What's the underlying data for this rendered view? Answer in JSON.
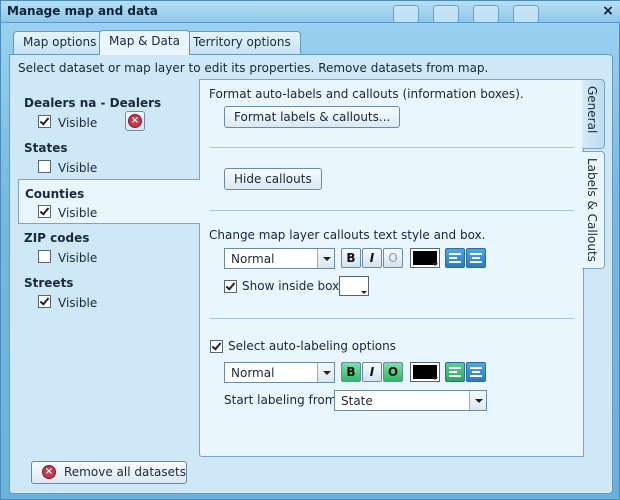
{
  "window": {
    "title": "Manage map and data",
    "close": "×"
  },
  "tabs": [
    {
      "label": "Map options",
      "active": false
    },
    {
      "label": "Map & Data",
      "active": true
    },
    {
      "label": "Territory options",
      "active": false
    }
  ],
  "info_text": "Select dataset or map layer to edit its properties. Remove datasets from map.",
  "layers": [
    {
      "name": "Dealers na - Dealers",
      "visible_label": "Visible",
      "visible": true,
      "selected": false,
      "removable": true
    },
    {
      "name": "States",
      "visible_label": "Visible",
      "visible": false,
      "selected": false
    },
    {
      "name": "Counties",
      "visible_label": "Visible",
      "visible": true,
      "selected": true
    },
    {
      "name": "ZIP codes",
      "visible_label": "Visible",
      "visible": false,
      "selected": false
    },
    {
      "name": "Streets",
      "visible_label": "Visible",
      "visible": true,
      "selected": false
    }
  ],
  "side_tabs": [
    {
      "label": "General",
      "active": false
    },
    {
      "label": "Labels & Callouts",
      "active": true
    }
  ],
  "labels_section": {
    "format_text": "Format auto-labels and callouts (information boxes).",
    "format_button": "Format labels & callouts...",
    "hide_callouts_button": "Hide callouts",
    "callouts_style_text": "Change map layer callouts text style and box.",
    "callouts_style_value": "Normal",
    "callouts_bold": "B",
    "callouts_italic": "I",
    "callouts_outline": "O",
    "callouts_text_color": "#000000",
    "show_inside_box_label": "Show inside box",
    "show_inside_box_checked": true,
    "box_color": "#ffffff",
    "auto_label_label": "Select auto-labeling options",
    "auto_label_checked": true,
    "auto_style_value": "Normal",
    "auto_bold": "B",
    "auto_italic": "I",
    "auto_outline": "O",
    "auto_text_color": "#000000",
    "start_labeling_label": "Start labeling from:",
    "start_labeling_value": "State"
  },
  "remove_all_button": "Remove all datasets",
  "colors": {
    "accent_green": "#2fb868",
    "align_blue": "#2f82c4",
    "remove_red": "#c33a4d"
  }
}
